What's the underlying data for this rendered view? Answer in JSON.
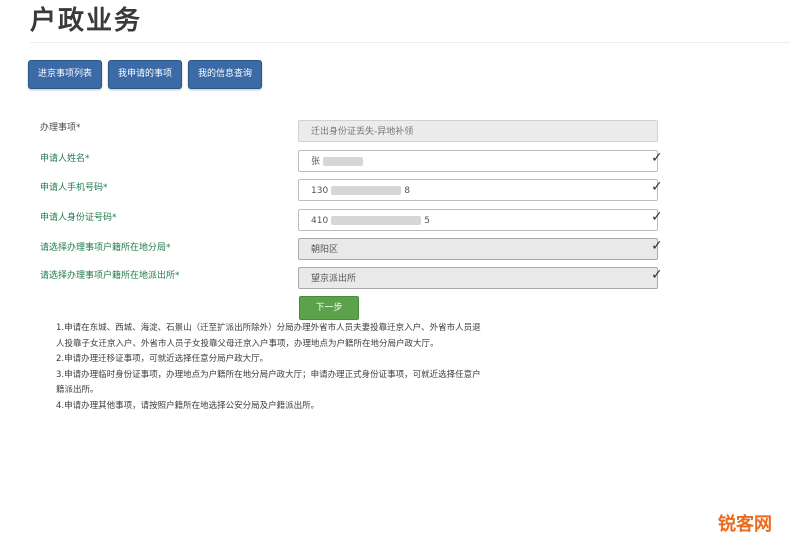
{
  "page": {
    "title": "户政业务"
  },
  "toolbar": {
    "buttons": [
      "进京事项列表",
      "我申请的事项",
      "我的信息查询"
    ]
  },
  "form": {
    "rows": [
      {
        "label": "办理事项*",
        "value": "迁出身份证丢失-异地补领"
      },
      {
        "label": "申请人姓名*",
        "value": "张"
      },
      {
        "label": "申请人手机号码*",
        "value": "130",
        "suffix": "8"
      },
      {
        "label": "申请人身份证号码*",
        "value": "410",
        "suffix": "5"
      },
      {
        "label": "请选择办理事项户籍所在地分局*",
        "value": "朝阳区"
      },
      {
        "label": "请选择办理事项户籍所在地派出所*",
        "value": "望京派出所"
      }
    ],
    "next_label": "下一步"
  },
  "notes": [
    "1.申请在东城、西城、海淀、石景山（迁至扩派出所除外）分局办理外省市人员夫妻投靠迁京入户、外省市人员退",
    "人投靠子女迁京入户、外省市人员子女投靠父母迁京入户事项，办理地点为户籍所在地分局户政大厅。",
    "2.申请办理迁移证事项，可就近选择任意分局户政大厅。",
    "3.申请办理临时身份证事项，办理地点为户籍所在地分局户政大厅；申请办理正式身份证事项，可就近选择任意户",
    "籍派出所。",
    "4.申请办理其他事项，请按照户籍所在地选择公安分局及户籍派出所。"
  ],
  "watermark": "锐客网",
  "colors": {
    "button_blue": "#3b6aa6",
    "label_green": "#1f7a4d",
    "next_green": "#5ba24a"
  }
}
